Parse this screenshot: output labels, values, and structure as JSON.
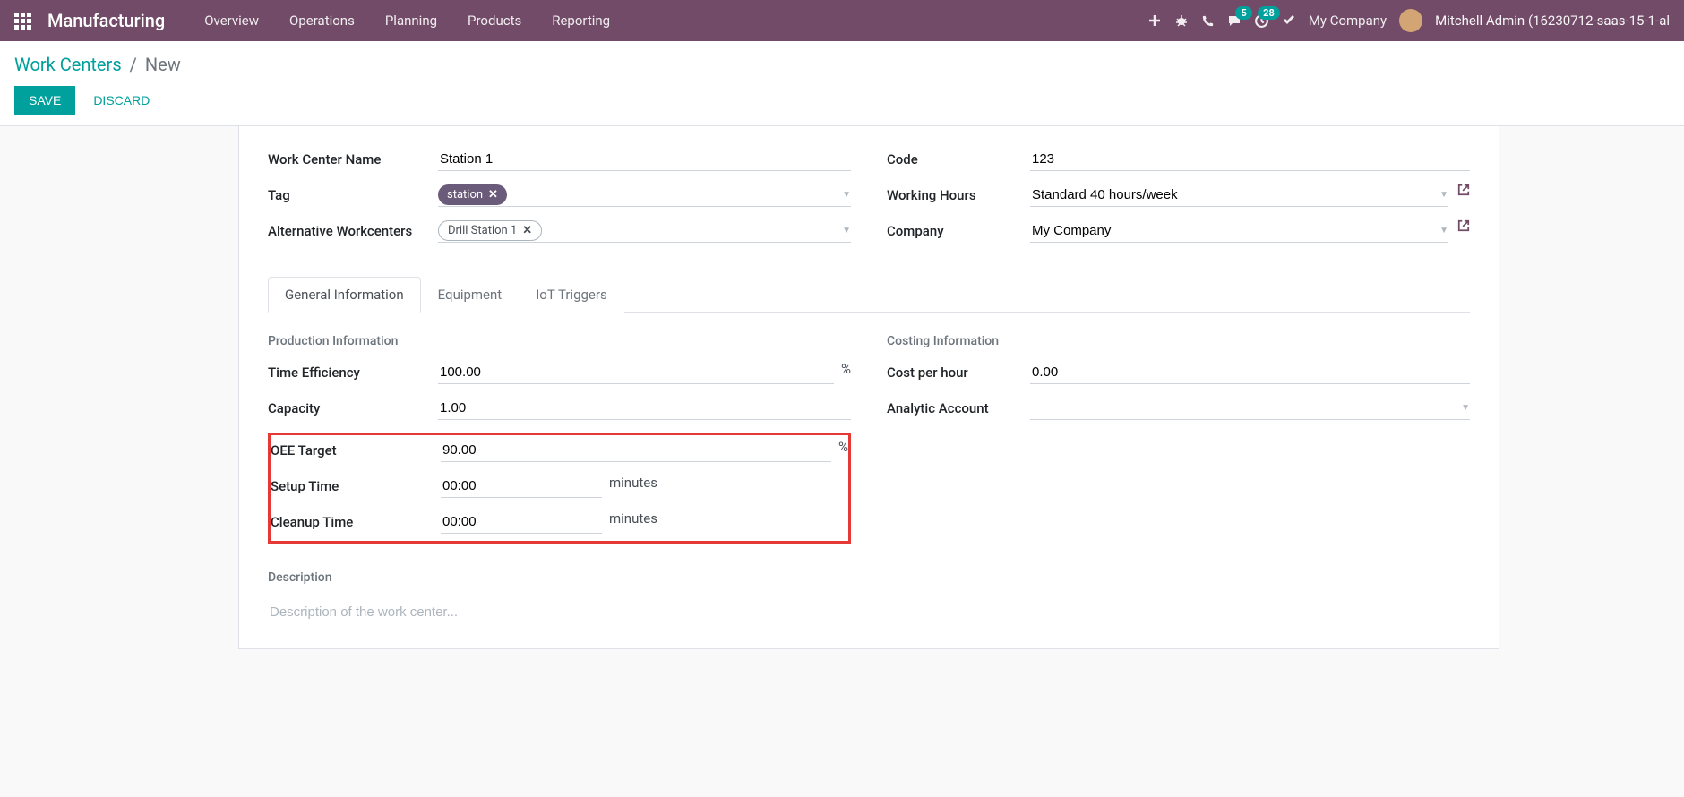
{
  "topbar": {
    "brand": "Manufacturing",
    "nav": [
      "Overview",
      "Operations",
      "Planning",
      "Products",
      "Reporting"
    ],
    "messages_badge": "5",
    "activities_badge": "28",
    "company": "My Company",
    "user": "Mitchell Admin (16230712-saas-15-1-al"
  },
  "breadcrumb": {
    "parent": "Work Centers",
    "current": "New"
  },
  "actions": {
    "save": "Save",
    "discard": "Discard"
  },
  "form": {
    "left": {
      "name_label": "Work Center Name",
      "name_value": "Station 1",
      "tag_label": "Tag",
      "tag_value": "station",
      "alt_label": "Alternative Workcenters",
      "alt_value": "Drill Station 1"
    },
    "right": {
      "code_label": "Code",
      "code_value": "123",
      "hours_label": "Working Hours",
      "hours_value": "Standard 40 hours/week",
      "company_label": "Company",
      "company_value": "My Company"
    }
  },
  "tabs": [
    "General Information",
    "Equipment",
    "IoT Triggers"
  ],
  "general": {
    "prod_title": "Production Information",
    "time_eff_label": "Time Efficiency",
    "time_eff_value": "100.00",
    "pct": "%",
    "capacity_label": "Capacity",
    "capacity_value": "1.00",
    "oee_label": "OEE Target",
    "oee_value": "90.00",
    "setup_label": "Setup Time",
    "setup_value": "00:00",
    "minutes": "minutes",
    "cleanup_label": "Cleanup Time",
    "cleanup_value": "00:00",
    "cost_title": "Costing Information",
    "cph_label": "Cost per hour",
    "cph_value": "0.00",
    "analytic_label": "Analytic Account",
    "desc_title": "Description",
    "desc_placeholder": "Description of the work center..."
  }
}
